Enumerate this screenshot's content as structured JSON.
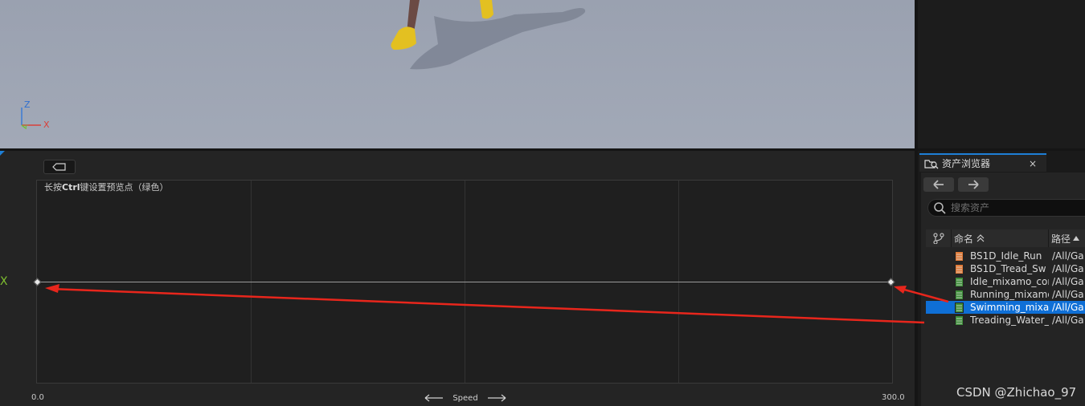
{
  "viewport": {
    "axis_z": "Z",
    "axis_x": "X",
    "axis_y": "Y"
  },
  "blendspace": {
    "hint_prefix": "长按",
    "hint_key": "Ctrl",
    "hint_suffix": "键设置预览点（绿色）",
    "axis_name": "Speed",
    "axis_min": "0.0",
    "axis_max": "300.0",
    "samples": [
      0,
      300
    ],
    "axis_range": [
      0,
      300
    ],
    "preview_marker": "X"
  },
  "asset_browser": {
    "tab_title": "资产浏览器",
    "tab_close": "×",
    "search_placeholder": "搜索资产",
    "columns": {
      "name": "命名",
      "path": "路径"
    },
    "rows": [
      {
        "name": "BS1D_Idle_Run",
        "path": "/All/Ga",
        "icon": "blendspace-icon",
        "selected": false
      },
      {
        "name": "BS1D_Tread_Sw",
        "path": "/All/Ga",
        "icon": "blendspace-icon",
        "selected": false
      },
      {
        "name": "Idle_mixamo_cor",
        "path": "/All/Ga",
        "icon": "anim-sequence-icon",
        "selected": false
      },
      {
        "name": "Running_mixamo",
        "path": "/All/Ga",
        "icon": "anim-sequence-icon",
        "selected": false
      },
      {
        "name": "Swimming_mixar",
        "path": "/All/Ga",
        "icon": "anim-sequence-icon",
        "selected": true
      },
      {
        "name": "Treading_Water_",
        "path": "/All/Ga",
        "icon": "anim-sequence-icon",
        "selected": false
      }
    ]
  },
  "watermark": "CSDN @Zhichao_97",
  "colors": {
    "accent": "#1e7fd6",
    "selection": "#0f6fd6",
    "annotation_arrow": "#e8261c",
    "preview_green": "#7fbf2f"
  }
}
